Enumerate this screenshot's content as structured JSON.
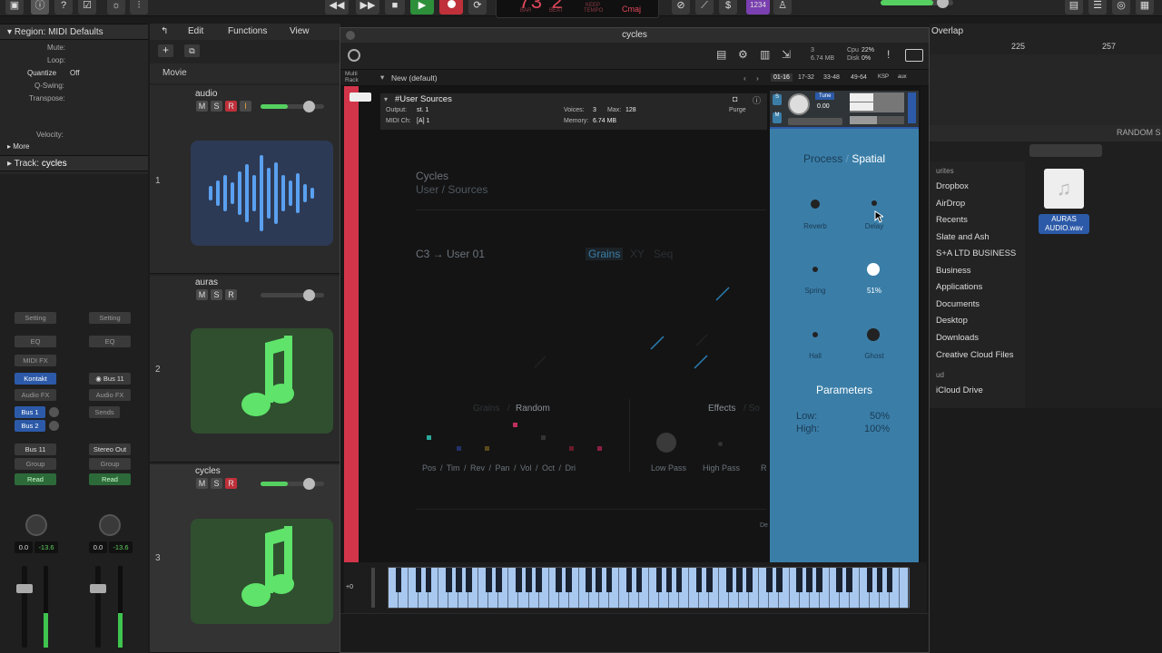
{
  "topbar": {
    "lcd_bar": "73",
    "lcd_beat": "2",
    "lcd_bar_lbl": "BAR",
    "lcd_beat_lbl": "BEAT",
    "lcd_keep": "KEEP",
    "lcd_tempo": "TEMPO",
    "lcd_key": "Cmaj",
    "badge": "1234"
  },
  "inspector": {
    "region_label": "Region:",
    "region_name": "MIDI Defaults",
    "mute": "Mute:",
    "loop": "Loop:",
    "quantize": "Quantize",
    "quantize_val": "Off",
    "qswing": "Q-Swing:",
    "transpose": "Transpose:",
    "velocity": "Velocity:",
    "more": "More",
    "track_label": "Track:",
    "track_name": "cycles",
    "setting": "Setting",
    "eq": "EQ",
    "midi_fx": "MIDI FX",
    "kontakt": "Kontakt",
    "audio_fx": "Audio FX",
    "bus11": "Bus 11",
    "bus1": "Bus 1",
    "bus2": "Bus 2",
    "sends": "Sends",
    "out1": "Bus 11",
    "out2": "Stereo Out",
    "group": "Group",
    "read": "Read",
    "vol1": "0.0",
    "pk1": "-13.6",
    "vol2": "0.0",
    "pk2": "-13.6"
  },
  "tracks_toolbar": {
    "edit": "Edit",
    "functions": "Functions",
    "view": "View",
    "movie": "Movie"
  },
  "tracks": [
    {
      "num": "1",
      "name": "audio"
    },
    {
      "num": "2",
      "name": "auras"
    },
    {
      "num": "3",
      "name": "cycles"
    }
  ],
  "window": {
    "title": "cycles",
    "voices_lbl": "Voices:",
    "voices": "3",
    "max_lbl": "Max:",
    "max": "128",
    "memory_lbl": "Memory:",
    "memory": "6.74 MB",
    "mem_top": "6.74 MB",
    "cpu": "Cpu",
    "cpu_val": "22%",
    "disk": "Disk",
    "disk_val": "0%",
    "multirack": "Multi Rack",
    "preset": "New (default)",
    "range_tabs": [
      "01-16",
      "17-32",
      "33-48",
      "49-64",
      "KSP",
      "aux"
    ],
    "instrument_name": "#User Sources",
    "output_lbl": "Output:",
    "output": "st. 1",
    "midich_lbl": "MIDI Ch:",
    "midich": "[A] 1",
    "purge": "Purge",
    "tune": "Tune",
    "tune_val": "0.00"
  },
  "cycles_ui": {
    "title": "Cycles",
    "subtitle_a": "User",
    "subtitle_b": "Sources",
    "slot": "C3 → User 01",
    "tab_grains": "Grains",
    "tab_xy": "XY",
    "tab_seq": "Seq",
    "grains_lbl": "Grains",
    "random_lbl": "Random",
    "mod_targets": "Pos / Tim / Rev / Pan / Vol / Oct / Dri",
    "effects_lbl": "Effects",
    "effects_tail": "So",
    "low_pass": "Low Pass",
    "high_pass": "High Pass",
    "r_cut": "R",
    "de_cut": "De",
    "process": "Process",
    "spatial": "Spatial",
    "reverb": "Reverb",
    "delay": "Delay",
    "spring": "Spring",
    "spring_val": "51%",
    "hall": "Hall",
    "ghost": "Ghost",
    "parameters": "Parameters",
    "low_lbl": "Low:",
    "low_val": "50%",
    "high_lbl": "High:",
    "high_val": "100%"
  },
  "keyboard": {
    "octave": "+0"
  },
  "right": {
    "overlap": "Overlap",
    "bar225": "225",
    "bar257": "257",
    "random_s": "RANDOM S",
    "favourites": "urites",
    "cloud": "ud",
    "sidebar": [
      "Dropbox",
      "AirDrop",
      "Recents",
      "Slate and Ash",
      "S+A LTD BUSINESS",
      "Business",
      "Applications",
      "Documents",
      "Desktop",
      "Downloads",
      "Creative Cloud Files"
    ],
    "icloud": "iCloud Drive",
    "file_name": "AURAS AUDIO.wav"
  },
  "colors": {
    "panel": "#3a7ea8",
    "accent_red": "#d2354a",
    "tile_audio": "#2d3a55",
    "tile_midi": "#2f4f2f",
    "note_green": "#5fe36a"
  }
}
